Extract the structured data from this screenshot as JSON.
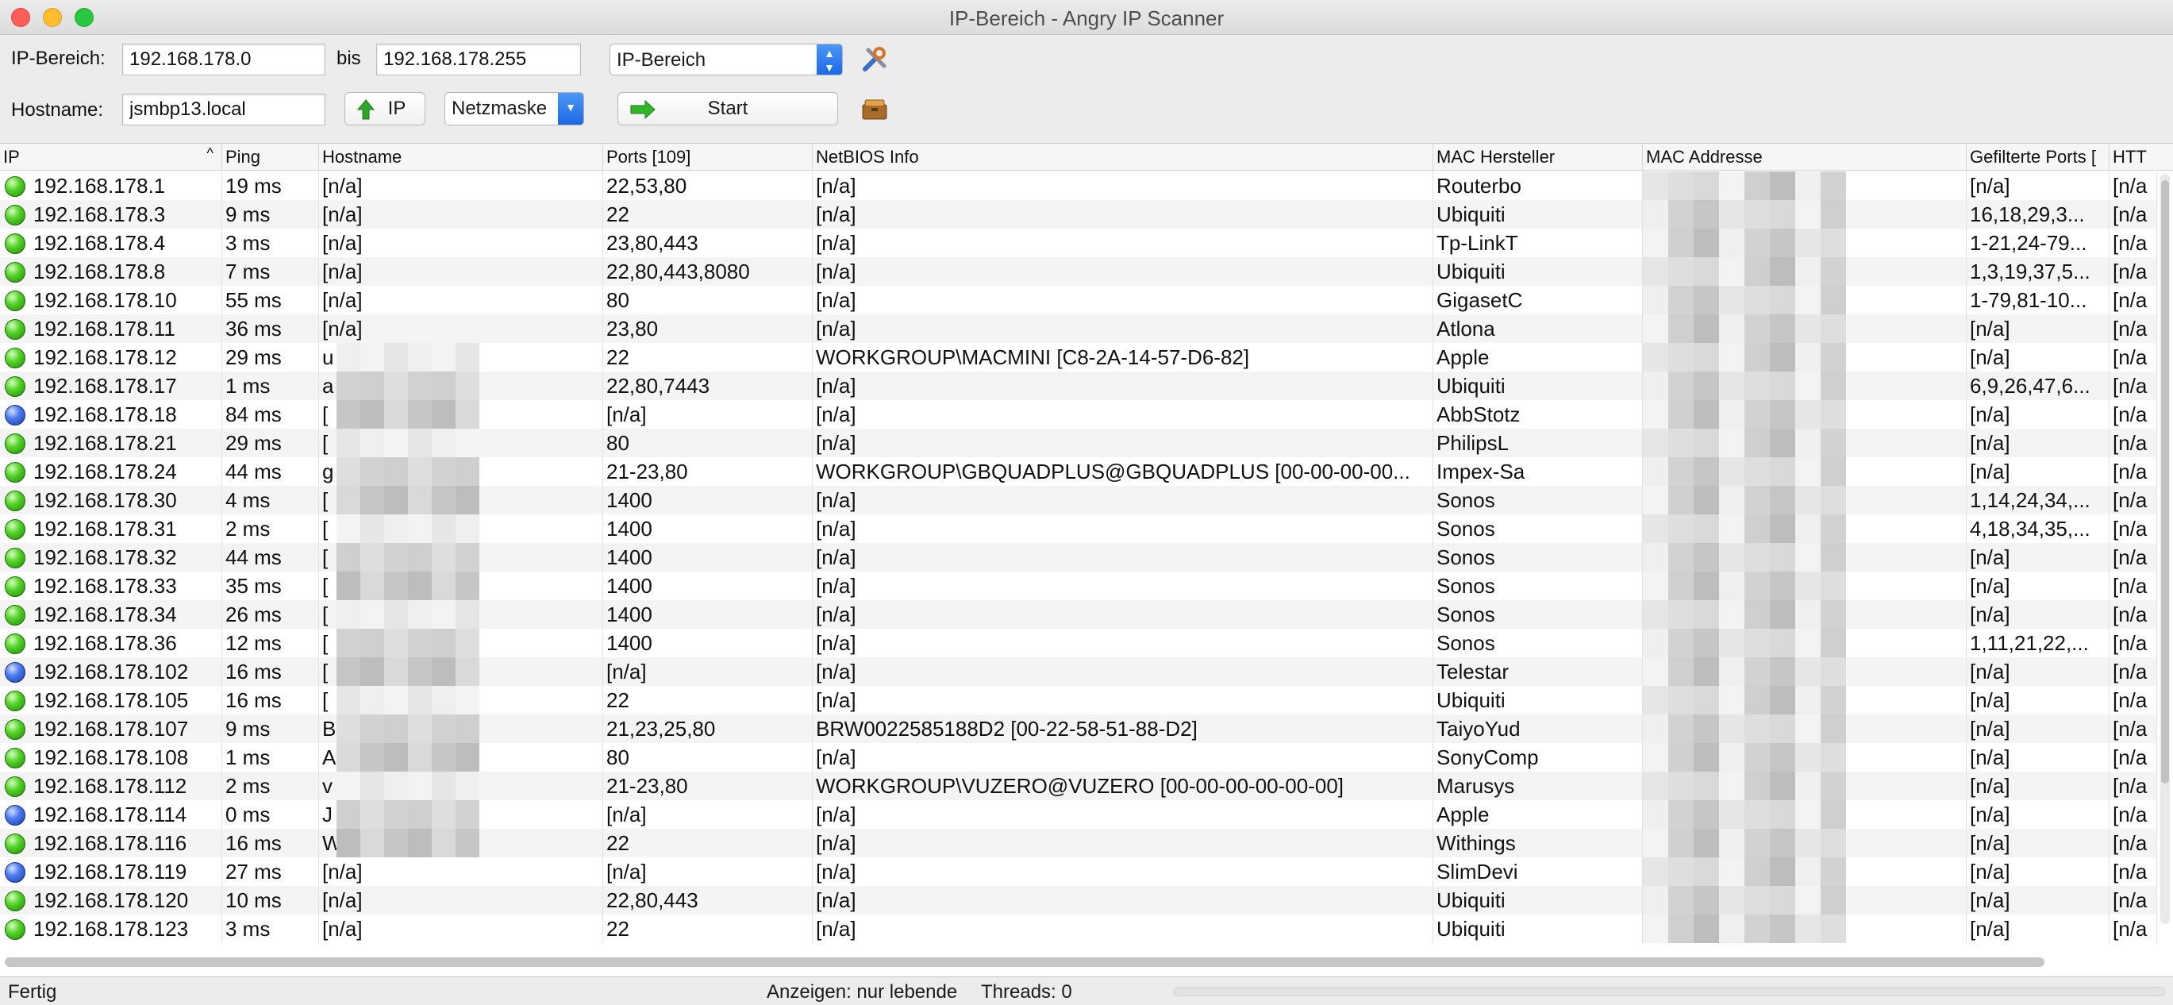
{
  "window": {
    "title": "IP-Bereich - Angry IP Scanner"
  },
  "toolbar": {
    "range_label": "IP-Bereich:",
    "range_start": "192.168.178.0",
    "bis_label": "bis",
    "range_end": "192.168.178.255",
    "mode_select": "IP-Bereich",
    "hostname_label": "Hostname:",
    "hostname_value": "jsmbp13.local",
    "ip_button": "IP",
    "netmask_select": "Netzmaske",
    "start_button": "Start"
  },
  "table": {
    "columns": [
      "IP",
      "Ping",
      "Hostname",
      "Ports [109]",
      "NetBIOS Info",
      "MAC Hersteller",
      "MAC Addresse",
      "Gefilterte Ports [",
      "HTT"
    ],
    "rows": [
      {
        "status": "green",
        "ip": "192.168.178.1",
        "ping": "19 ms",
        "host": "[n/a]",
        "ports": "22,53,80",
        "netbios": "[n/a]",
        "vendor": "Routerbo",
        "filtered": "[n/a]",
        "http": "[n/a"
      },
      {
        "status": "green",
        "ip": "192.168.178.3",
        "ping": "9 ms",
        "host": "[n/a]",
        "ports": "22",
        "netbios": "[n/a]",
        "vendor": "Ubiquiti",
        "filtered": "16,18,29,3...",
        "http": "[n/a"
      },
      {
        "status": "green",
        "ip": "192.168.178.4",
        "ping": "3 ms",
        "host": "[n/a]",
        "ports": "23,80,443",
        "netbios": "[n/a]",
        "vendor": "Tp-LinkT",
        "filtered": "1-21,24-79...",
        "http": "[n/a"
      },
      {
        "status": "green",
        "ip": "192.168.178.8",
        "ping": "7 ms",
        "host": "[n/a]",
        "ports": "22,80,443,8080",
        "netbios": "[n/a]",
        "vendor": "Ubiquiti",
        "filtered": "1,3,19,37,5...",
        "http": "[n/a"
      },
      {
        "status": "green",
        "ip": "192.168.178.10",
        "ping": "55 ms",
        "host": "[n/a]",
        "ports": "80",
        "netbios": "[n/a]",
        "vendor": "GigasetC",
        "filtered": "1-79,81-10...",
        "http": "[n/a"
      },
      {
        "status": "green",
        "ip": "192.168.178.11",
        "ping": "36 ms",
        "host": "[n/a]",
        "ports": "23,80",
        "netbios": "[n/a]",
        "vendor": "Atlona",
        "filtered": "[n/a]",
        "http": "[n/a"
      },
      {
        "status": "green",
        "ip": "192.168.178.12",
        "ping": "29 ms",
        "host": "u",
        "ports": "22",
        "netbios": "WORKGROUP\\MACMINI [C8-2A-14-57-D6-82]",
        "vendor": "Apple",
        "filtered": "[n/a]",
        "http": "[n/a"
      },
      {
        "status": "green",
        "ip": "192.168.178.17",
        "ping": "1 ms",
        "host": "a",
        "ports": "22,80,7443",
        "netbios": "[n/a]",
        "vendor": "Ubiquiti",
        "filtered": "6,9,26,47,6...",
        "http": "[n/a"
      },
      {
        "status": "blue",
        "ip": "192.168.178.18",
        "ping": "84 ms",
        "host": "[",
        "ports": "[n/a]",
        "netbios": "[n/a]",
        "vendor": "AbbStotz",
        "filtered": "[n/a]",
        "http": "[n/a"
      },
      {
        "status": "green",
        "ip": "192.168.178.21",
        "ping": "29 ms",
        "host": "[",
        "ports": "80",
        "netbios": "[n/a]",
        "vendor": "PhilipsL",
        "filtered": "[n/a]",
        "http": "[n/a"
      },
      {
        "status": "green",
        "ip": "192.168.178.24",
        "ping": "44 ms",
        "host": "g",
        "ports": "21-23,80",
        "netbios": "WORKGROUP\\GBQUADPLUS@GBQUADPLUS [00-00-00-00...",
        "vendor": "Impex-Sa",
        "filtered": "[n/a]",
        "http": "[n/a"
      },
      {
        "status": "green",
        "ip": "192.168.178.30",
        "ping": "4 ms",
        "host": "[",
        "ports": "1400",
        "netbios": "[n/a]",
        "vendor": "Sonos",
        "filtered": "1,14,24,34,...",
        "http": "[n/a"
      },
      {
        "status": "green",
        "ip": "192.168.178.31",
        "ping": "2 ms",
        "host": "[",
        "ports": "1400",
        "netbios": "[n/a]",
        "vendor": "Sonos",
        "filtered": "4,18,34,35,...",
        "http": "[n/a"
      },
      {
        "status": "green",
        "ip": "192.168.178.32",
        "ping": "44 ms",
        "host": "[",
        "ports": "1400",
        "netbios": "[n/a]",
        "vendor": "Sonos",
        "filtered": "[n/a]",
        "http": "[n/a"
      },
      {
        "status": "green",
        "ip": "192.168.178.33",
        "ping": "35 ms",
        "host": "[",
        "ports": "1400",
        "netbios": "[n/a]",
        "vendor": "Sonos",
        "filtered": "[n/a]",
        "http": "[n/a"
      },
      {
        "status": "green",
        "ip": "192.168.178.34",
        "ping": "26 ms",
        "host": "[",
        "ports": "1400",
        "netbios": "[n/a]",
        "vendor": "Sonos",
        "filtered": "[n/a]",
        "http": "[n/a"
      },
      {
        "status": "green",
        "ip": "192.168.178.36",
        "ping": "12 ms",
        "host": "[",
        "ports": "1400",
        "netbios": "[n/a]",
        "vendor": "Sonos",
        "filtered": "1,11,21,22,...",
        "http": "[n/a"
      },
      {
        "status": "blue",
        "ip": "192.168.178.102",
        "ping": "16 ms",
        "host": "[",
        "ports": "[n/a]",
        "netbios": "[n/a]",
        "vendor": "Telestar",
        "filtered": "[n/a]",
        "http": "[n/a"
      },
      {
        "status": "green",
        "ip": "192.168.178.105",
        "ping": "16 ms",
        "host": "[",
        "ports": "22",
        "netbios": "[n/a]",
        "vendor": "Ubiquiti",
        "filtered": "[n/a]",
        "http": "[n/a"
      },
      {
        "status": "green",
        "ip": "192.168.178.107",
        "ping": "9 ms",
        "host": "B",
        "ports": "21,23,25,80",
        "netbios": "BRW0022585188D2 [00-22-58-51-88-D2]",
        "vendor": "TaiyoYud",
        "filtered": "[n/a]",
        "http": "[n/a"
      },
      {
        "status": "green",
        "ip": "192.168.178.108",
        "ping": "1 ms",
        "host": "A",
        "ports": "80",
        "netbios": "[n/a]",
        "vendor": "SonyComp",
        "filtered": "[n/a]",
        "http": "[n/a"
      },
      {
        "status": "green",
        "ip": "192.168.178.112",
        "ping": "2 ms",
        "host": "v",
        "ports": "21-23,80",
        "netbios": "WORKGROUP\\VUZERO@VUZERO [00-00-00-00-00-00]",
        "vendor": "Marusys",
        "filtered": "[n/a]",
        "http": "[n/a"
      },
      {
        "status": "blue",
        "ip": "192.168.178.114",
        "ping": "0 ms",
        "host": "J",
        "ports": "[n/a]",
        "netbios": "[n/a]",
        "vendor": "Apple",
        "filtered": "[n/a]",
        "http": "[n/a"
      },
      {
        "status": "green",
        "ip": "192.168.178.116",
        "ping": "16 ms",
        "host": "W",
        "ports": "22",
        "netbios": "[n/a]",
        "vendor": "Withings",
        "filtered": "[n/a]",
        "http": "[n/a"
      },
      {
        "status": "blue",
        "ip": "192.168.178.119",
        "ping": "27 ms",
        "host": "[n/a]",
        "ports": "[n/a]",
        "netbios": "[n/a]",
        "vendor": "SlimDevi",
        "filtered": "[n/a]",
        "http": "[n/a"
      },
      {
        "status": "green",
        "ip": "192.168.178.120",
        "ping": "10 ms",
        "host": "[n/a]",
        "ports": "22,80,443",
        "netbios": "[n/a]",
        "vendor": "Ubiquiti",
        "filtered": "[n/a]",
        "http": "[n/a"
      },
      {
        "status": "green",
        "ip": "192.168.178.123",
        "ping": "3 ms",
        "host": "[n/a]",
        "ports": "22",
        "netbios": "[n/a]",
        "vendor": "Ubiquiti",
        "filtered": "[n/a]",
        "http": "[n/a"
      }
    ]
  },
  "status": {
    "left": "Fertig",
    "display": "Anzeigen: nur lebende",
    "threads": "Threads: 0"
  },
  "colors": {
    "online": "#3fbf1a",
    "dead": "#2f5bd8",
    "accent": "#1c69e6"
  },
  "icons": [
    "preferences-icon",
    "fetchers-icon",
    "arrow-up-icon",
    "start-arrow-icon"
  ]
}
